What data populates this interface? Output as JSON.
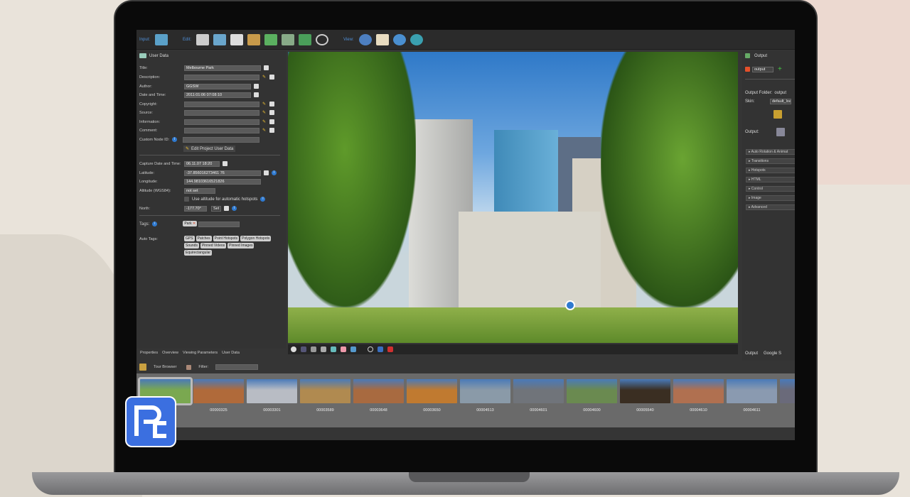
{
  "toolbar": {
    "input_label": "Input:",
    "edit_label": "Edit:",
    "view_label": "View:"
  },
  "user_data": {
    "title": "User Data",
    "fields": [
      {
        "label": "Title:",
        "value": "Melbourne Park"
      },
      {
        "label": "Description:",
        "value": ""
      },
      {
        "label": "Author:",
        "value": "GGSW"
      },
      {
        "label": "Date and Time:",
        "value": "2011:01:06 07:08:10"
      },
      {
        "label": "Copyright:",
        "value": ""
      },
      {
        "label": "Source:",
        "value": ""
      },
      {
        "label": "Information:",
        "value": ""
      },
      {
        "label": "Comment:",
        "value": ""
      },
      {
        "label": "Custom Node ID:",
        "value": ""
      }
    ],
    "edit_project_button": "Edit Project User Data",
    "capture_label": "Capture Date and Time:",
    "capture_value": "06.11.07 18:20",
    "latitude_label": "Latitude:",
    "latitude_value": "-37.856016273461 76",
    "longitude_label": "Longitude:",
    "longitude_value": "144.98103616521826",
    "altitude_label": "Altitude (WGS84):",
    "altitude_value": "not set",
    "use_altitude_label": "Use altitude for automatic hotspots",
    "north_label": "North:",
    "north_value": "-177.70°",
    "set_button": "Set",
    "tags_label": "Tags:",
    "tag": "Park",
    "auto_tags_label": "Auto Tags:",
    "auto_tags": [
      "GPS",
      "Patches",
      "Point Hotspots",
      "Polygon Hotspots",
      "Sounds",
      "Pinned Videos",
      "Pinned Images",
      "Equirectangular"
    ]
  },
  "tabs": [
    "Properties",
    "Overview",
    "Viewing Parameters",
    "User Data"
  ],
  "output": {
    "title": "Output",
    "format": "output",
    "folder_label": "Output Folder:",
    "folder_value": "output",
    "skin_label": "Skin:",
    "skin_value": "default_loa",
    "output_label": "Output:",
    "sections": [
      "Auto Rotation & Animat",
      "Transitions",
      "Hotspots",
      "HTML",
      "Control",
      "Image",
      "Advanced"
    ],
    "bottom_tabs": [
      "Output",
      "Google S"
    ]
  },
  "tour": {
    "title": "Tour Browser",
    "filter_label": "Filter:",
    "thumbnails": [
      "",
      "00000325",
      "00003301",
      "00003589",
      "00003648",
      "00003650",
      "00004513",
      "00004601",
      "00004600",
      "00005540",
      "00004610",
      "00004611",
      ""
    ]
  }
}
